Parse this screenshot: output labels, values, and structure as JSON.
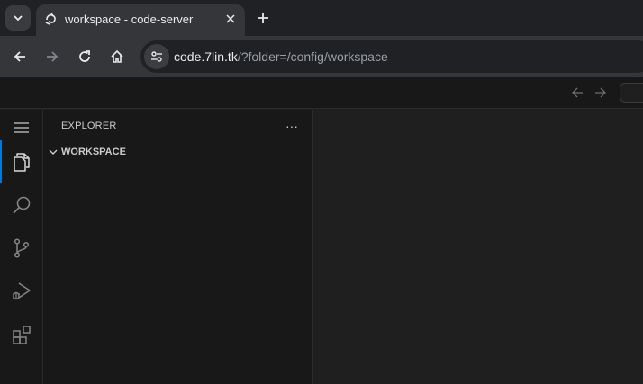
{
  "browser": {
    "tab": {
      "title": "workspace - code-server",
      "favicon": "code-server-logo-icon"
    },
    "url": {
      "host": "code.7lin.tk",
      "path": "/?folder=/config/workspace"
    },
    "icons": {
      "tab_search": "chevron-down-icon",
      "tab_close": "close-icon",
      "new_tab": "plus-icon",
      "back": "arrow-left-icon",
      "forward": "arrow-right-icon",
      "reload": "reload-icon",
      "home": "home-icon",
      "site_info": "tune-icon"
    }
  },
  "vscode": {
    "sidebar": {
      "title": "EXPLORER",
      "more": "···",
      "section": "WORKSPACE"
    },
    "activity_bar": [
      "menu-icon",
      "explorer-icon",
      "search-icon",
      "source-control-icon",
      "run-debug-icon",
      "extensions-icon"
    ]
  },
  "colors": {
    "accent": "#0078d4",
    "tabstrip": "#202124",
    "toolbar": "#35363a",
    "sidebar_bg": "#181818",
    "editor_bg": "#1f1f1f"
  }
}
